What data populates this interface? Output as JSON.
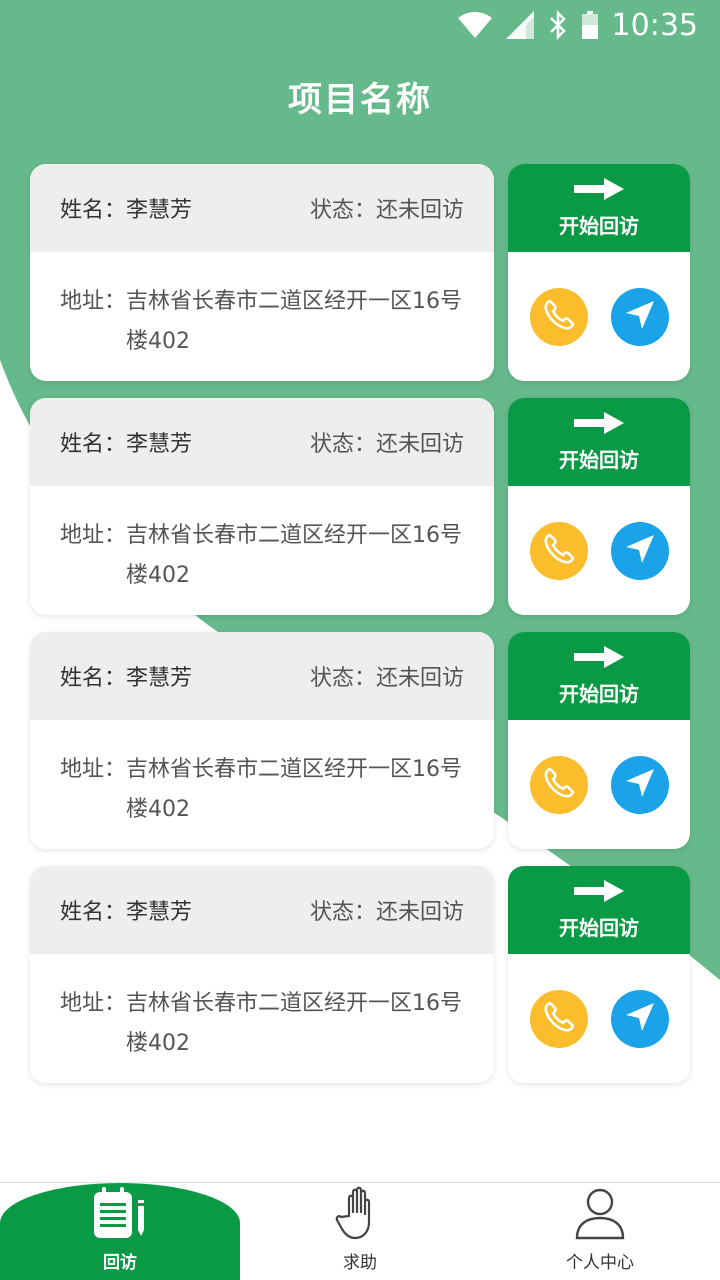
{
  "status_bar": {
    "time": "10:35",
    "icons": [
      "wifi-icon",
      "signal-icon",
      "bluetooth-icon",
      "battery-icon"
    ]
  },
  "header": {
    "title": "项目名称"
  },
  "colors": {
    "primary_green": "#0a9a46",
    "background_green": "#66b98a",
    "phone_yellow": "#fbbd2b",
    "nav_blue": "#1aa3e8",
    "header_gray": "#eeeeee"
  },
  "visits": [
    {
      "name_label": "姓名：",
      "name": "李慧芳",
      "status_label": "状态：",
      "status": "还未回访",
      "address_label": "地址：",
      "address": "吉林省长春市二道区经开一区16号楼402",
      "start_label": "开始回访"
    },
    {
      "name_label": "姓名：",
      "name": "李慧芳",
      "status_label": "状态：",
      "status": "还未回访",
      "address_label": "地址：",
      "address": "吉林省长春市二道区经开一区16号楼402",
      "start_label": "开始回访"
    },
    {
      "name_label": "姓名：",
      "name": "李慧芳",
      "status_label": "状态：",
      "status": "还未回访",
      "address_label": "地址：",
      "address": "吉林省长春市二道区经开一区16号楼402",
      "start_label": "开始回访"
    },
    {
      "name_label": "姓名：",
      "name": "李慧芳",
      "status_label": "状态：",
      "status": "还未回访",
      "address_label": "地址：",
      "address": "吉林省长春市二道区经开一区16号楼402",
      "start_label": "开始回访"
    }
  ],
  "bottom_nav": {
    "items": [
      {
        "label": "回访",
        "icon": "notepad-icon",
        "active": true
      },
      {
        "label": "求助",
        "icon": "hand-icon",
        "active": false
      },
      {
        "label": "个人中心",
        "icon": "user-icon",
        "active": false
      }
    ]
  }
}
